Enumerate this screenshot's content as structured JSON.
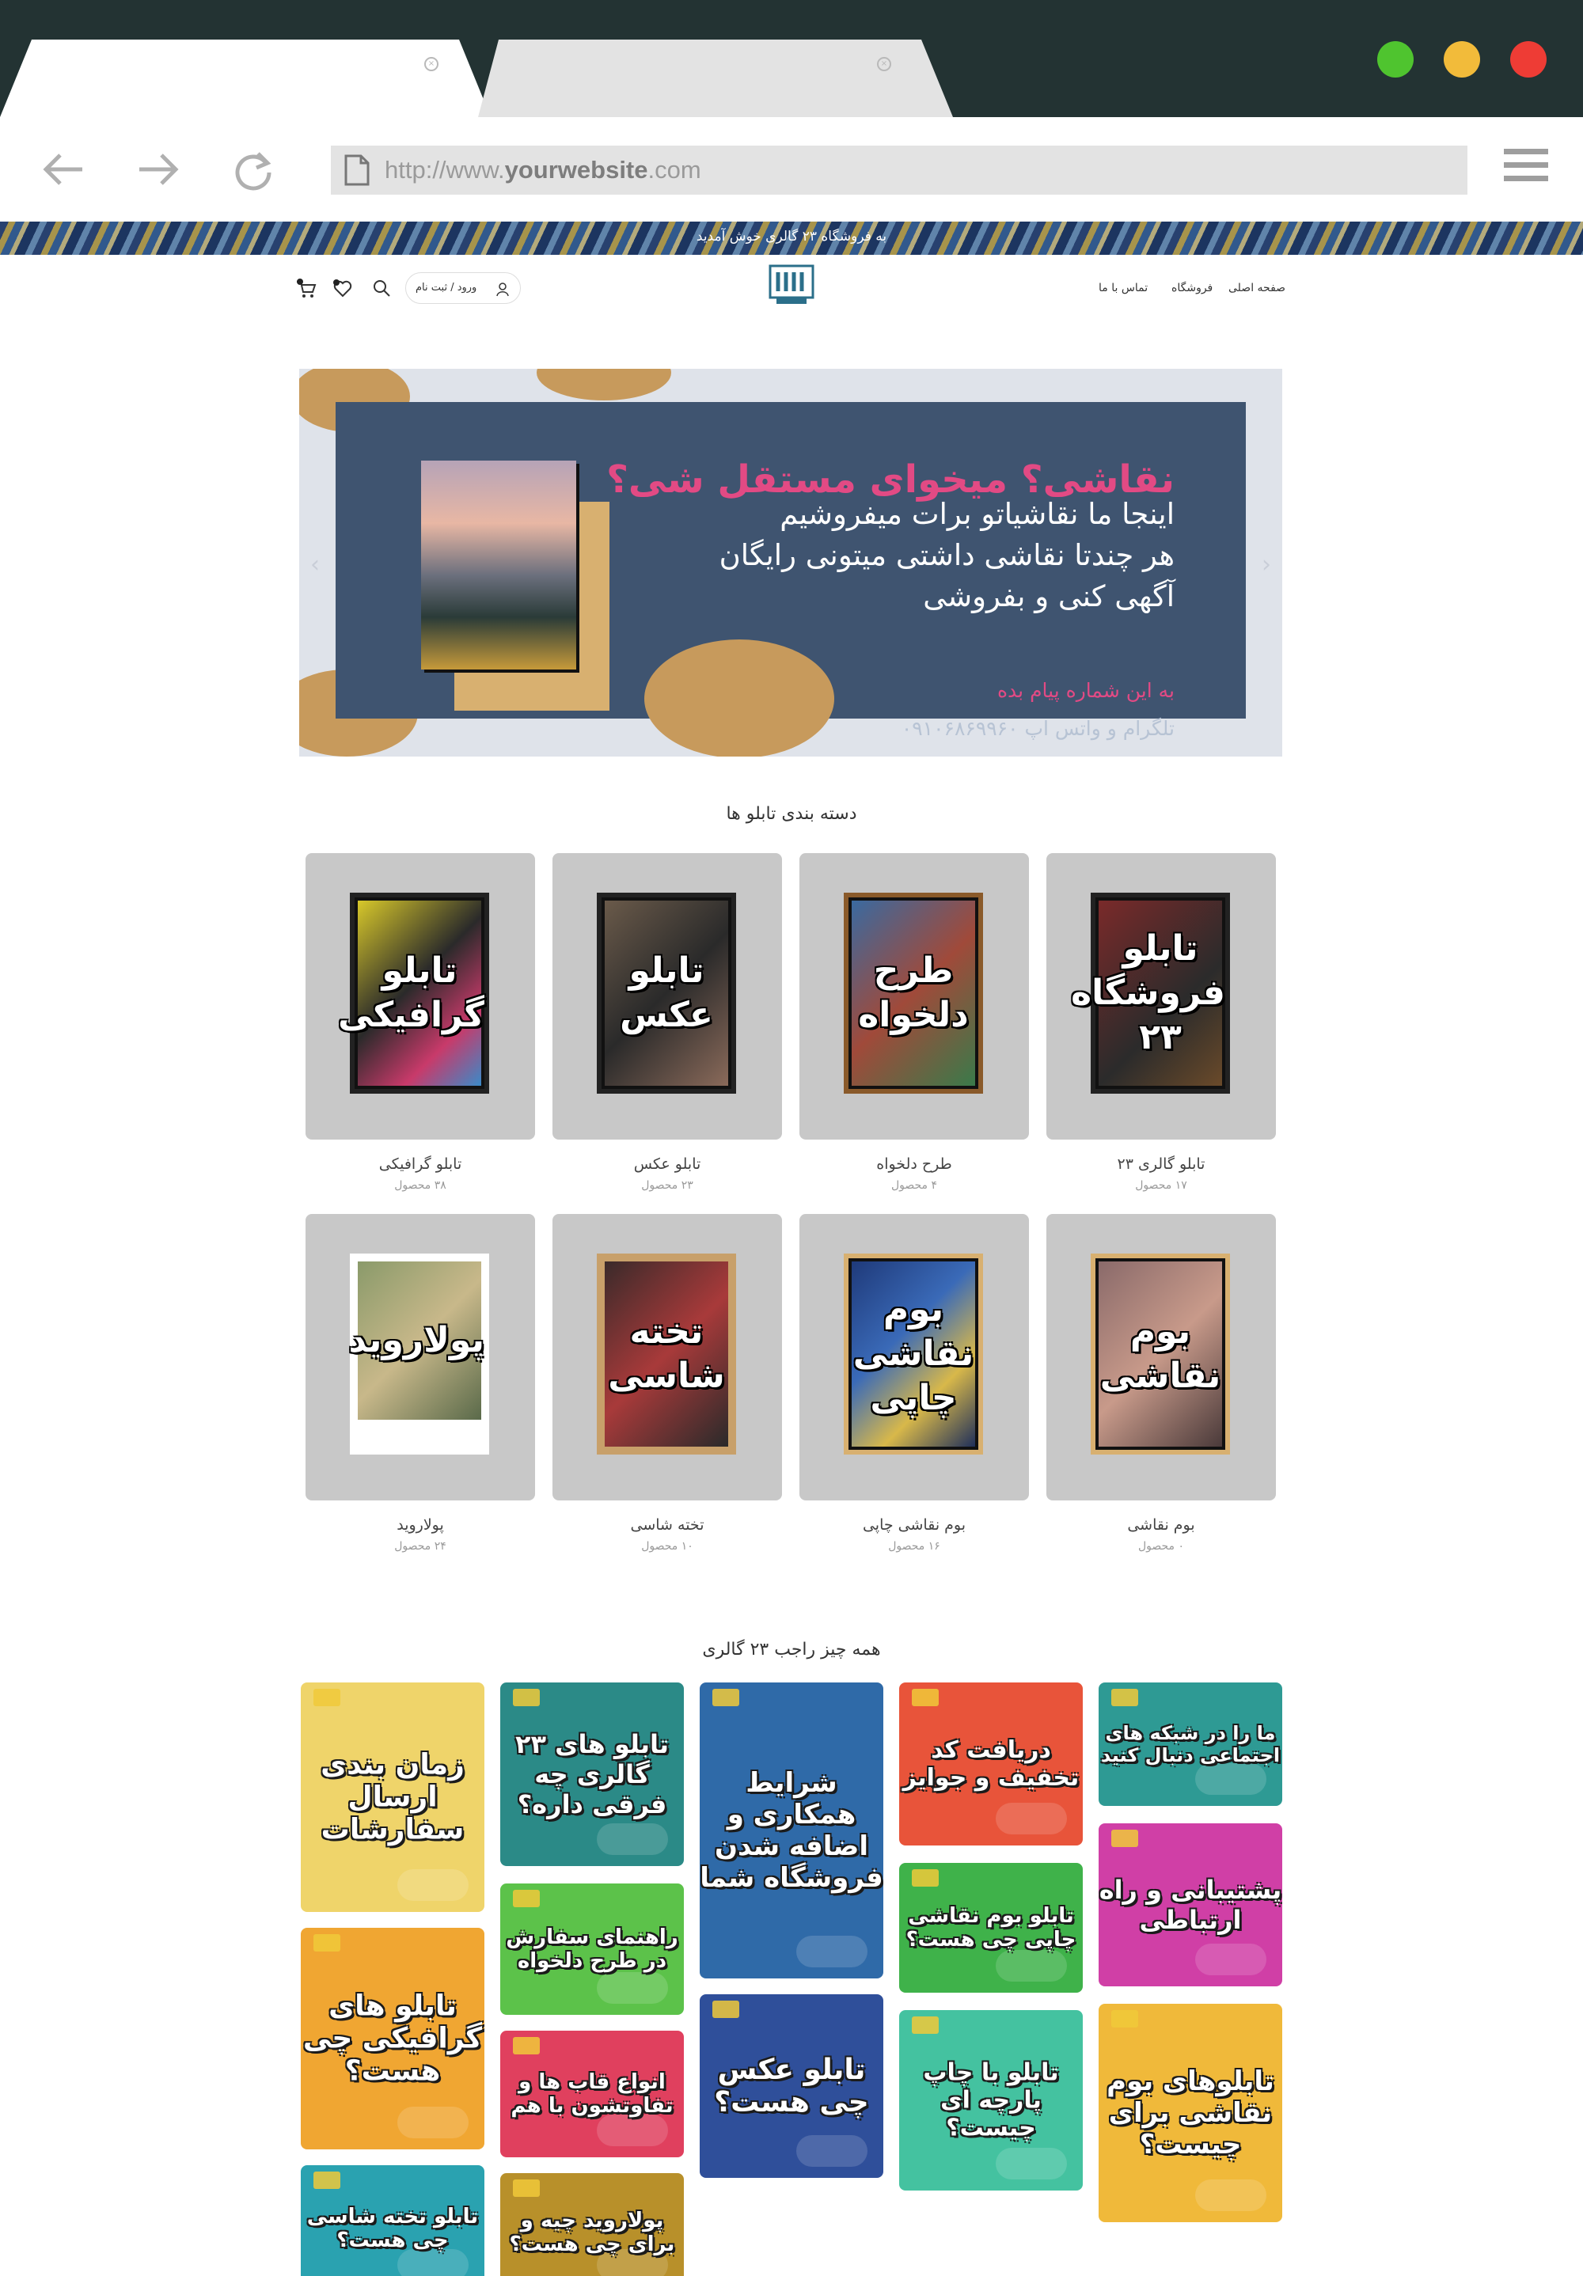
{
  "browser": {
    "url_prefix": "http://www.",
    "url_domain": "yourwebsite",
    "url_suffix": ".com",
    "tab_close_glyph": "×",
    "window_dots": [
      "#4fc42f",
      "#f2bb3a",
      "#ee3c35"
    ]
  },
  "site": {
    "announcement": "به فروشگاه ۲۳ گالری خوش آمدید",
    "nav": {
      "home": "صفحه اصلی",
      "shop": "فروشگاه",
      "contact": "تماس با ما"
    },
    "login_label": "ورود / ثبت نام",
    "hero": {
      "title": "نقاشی؟ میخوای مستقل شی؟",
      "line1": "اینجا ما نقاشیاتو برات میفروشیم",
      "line2": "هر چندتا نقاشی داشتی میتونی رایگان",
      "line3": "آگهی کنی و بفروشی",
      "sub1": "به این شماره پیام بده",
      "sub2": "تلگرام و واتس اپ ۰۹۱۰۶۸۶۹۹۶۰"
    },
    "categories_title": "دسته بندی تابلو ها",
    "categories": [
      {
        "art": "تابلو فروشگاه ۲۳",
        "name": "تابلو گالری ۲۳",
        "count": "۱۷ محصول"
      },
      {
        "art": "طرح دلخواه",
        "name": "طرح دلخواه",
        "count": "۴ محصول"
      },
      {
        "art": "تابلو عکس",
        "name": "تابلو عکس",
        "count": "۲۳ محصول"
      },
      {
        "art": "تابلو گرافیکی",
        "name": "تابلو گرافیکی",
        "count": "۳۸ محصول"
      },
      {
        "art": "بوم نقاشی",
        "name": "بوم نقاشی",
        "count": "۰ محصول"
      },
      {
        "art": "بوم نقاشی چاپی",
        "name": "بوم نقاشی چاپی",
        "count": "۱۶ محصول"
      },
      {
        "art": "تخته شاسی",
        "name": "تخته شاسی",
        "count": "۱۰ محصول"
      },
      {
        "art": "پولاروید",
        "name": "پولاروید",
        "count": "۲۴ محصول"
      }
    ],
    "blog_title": "همه چیز راجب ۲۳ گالری",
    "tiles": [
      {
        "text": "ما را در شبکه های اجتماعی دنبال کنید",
        "color": "#2e9a94"
      },
      {
        "text": "پشتیبانی و راه ارتباطی",
        "color": "#d03fa6"
      },
      {
        "text": "تابلوهای بوم نقاشی برای چیست؟",
        "color": "#f0b93a"
      },
      {
        "text": "دریافت کد تخفیف و جوایز",
        "color": "#e8543a"
      },
      {
        "text": "تابلو بوم نقاشی چاپی چی هست؟",
        "color": "#3fb24a"
      },
      {
        "text": "تابلو با چاپ پارچه ای چیست؟",
        "color": "#44c2a0"
      },
      {
        "text": "شرایط همکاری و اضافه شدن فروشگاه شما",
        "color": "#2f6aa8"
      },
      {
        "text": "تابلو عکس چی هست؟",
        "color": "#2f4f9a"
      },
      {
        "text": "تابلو های ۲۳ گالری چه فرقی داره؟",
        "color": "#2b8a87"
      },
      {
        "text": "راهنمای سفارش در طرح دلخواه",
        "color": "#5cc24a"
      },
      {
        "text": "انواع قاب ها و تفاوتشون با هم",
        "color": "#e0405e"
      },
      {
        "text": "پولاروید چیه و برای چی هست؟",
        "color": "#b8902a"
      },
      {
        "text": "زمان بندی ارسال سفارشات",
        "color": "#efd46a"
      },
      {
        "text": "تابلو های گرافیکی چی هست؟",
        "color": "#f0a632"
      },
      {
        "text": "تابلو تخته شاسی چی هست؟",
        "color": "#2aa2b0"
      }
    ]
  }
}
